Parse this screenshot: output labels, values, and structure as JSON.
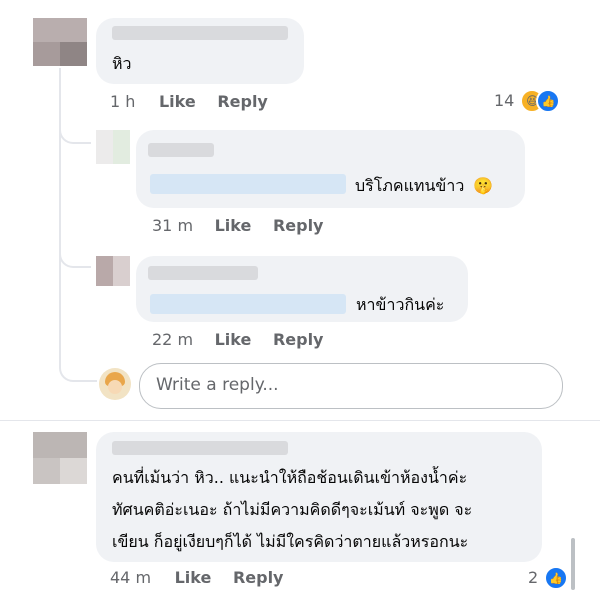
{
  "comments": {
    "c1": {
      "text": "หิว",
      "time": "1 h",
      "like": "Like",
      "reply": "Reply",
      "reaction_count": "14"
    },
    "r1": {
      "text": "บริโภคแทนข้าว",
      "emoji": "🤫",
      "time": "31 m",
      "like": "Like",
      "reply": "Reply"
    },
    "r2": {
      "text": "หาข้าวกินค่ะ",
      "time": "22 m",
      "like": "Like",
      "reply": "Reply"
    },
    "c2": {
      "line1": "คนที่เม้นว่า หิว.. แนะนำให้ถือช้อนเดินเข้าห้องน้ำค่ะ",
      "line2": "ทัศนคติอ่ะเนอะ ถ้าไม่มีความคิดดีๆจะเม้นท์ จะพูด จะ",
      "line3": "เขียน ก็อยู่เงียบๆก็ได้ ไม่มีใครคิดว่าตายแล้วหรอกนะ",
      "time": "44 m",
      "like": "Like",
      "reply": "Reply",
      "reaction_count": "2"
    }
  },
  "reply_box": {
    "placeholder": "Write a reply..."
  },
  "icons": {
    "laugh": "laugh-emoji-icon",
    "like": "thumbs-up-icon"
  },
  "colors": {
    "bubble": "#f0f2f5",
    "meta": "#65676b",
    "like_blue": "#1877f2",
    "laugh_yellow": "#f7b125"
  }
}
